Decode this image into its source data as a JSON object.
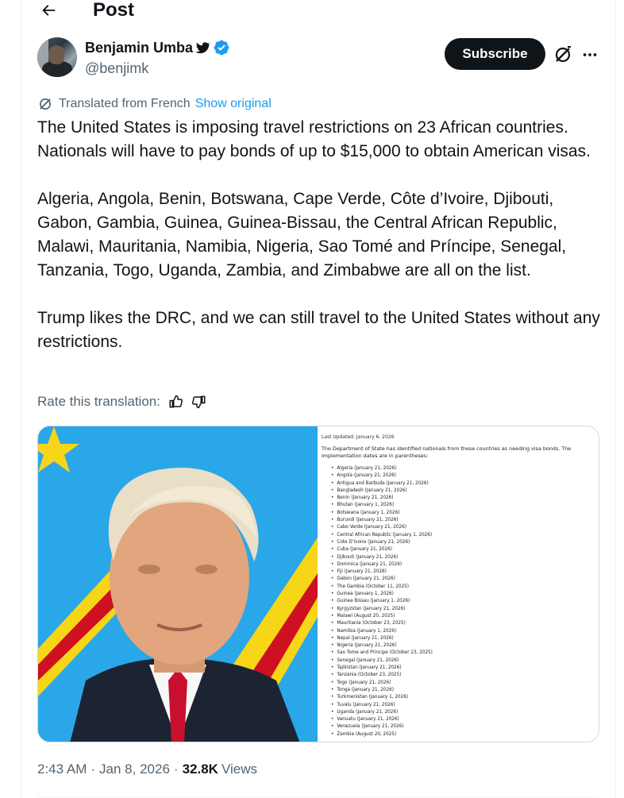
{
  "header": {
    "title": "Post"
  },
  "author": {
    "display_name": "Benjamin Umba",
    "handle": "@benjimk",
    "badge_emoji": "bird-icon",
    "verified": true
  },
  "actions": {
    "subscribe_label": "Subscribe"
  },
  "translation": {
    "note": "Translated from French",
    "show_original": "Show original",
    "rate_label": "Rate this translation:"
  },
  "tweet": {
    "paragraphs": [
      "The United States is imposing travel restrictions on 23 African countries. Nationals will have to pay bonds of up to $15,000 to obtain American visas.",
      "Algeria, Angola, Benin, Botswana, Cape Verde, Côte d’Ivoire, Djibouti, Gabon, Gambia, Guinea, Guinea-Bissau, the Central African Republic, Malawi, Mauritania, Namibia, Nigeria, Sao Tomé and Príncipe, Senegal, Tanzania, Togo, Uganda, Zambia, and Zimbabwe are all on the list.",
      "Trump likes the DRC, and we can still travel to the United States without any restrictions."
    ]
  },
  "media": {
    "doc": {
      "updated": "Last Updated: January 6, 2026",
      "intro": "The Department of State has identified nationals from these countries as needing visa bonds.  The implementation dates are in parentheses:",
      "items": [
        "Algeria (January 21, 2026)",
        "Angola (January 21, 2026)",
        "Antigua and Barbuda (January 21, 2026)",
        "Bangladesh (January 21, 2026)",
        "Benin (January 21, 2026)",
        "Bhutan (January 1, 2026)",
        "Botswana (January 1, 2026)",
        "Burundi (January 21, 2026)",
        "Cabo Verde (January 21, 2026)",
        "Central African Republic (January 1, 2026)",
        "Cote D’Ivoire (January 21, 2026)",
        "Cuba (January 21, 2026)",
        "Djibouti (January 21, 2026)",
        "Dominica (January 21, 2026)",
        "Fiji (January 21, 2026)",
        "Gabon (January 21, 2026)",
        "The Gambia (October 11, 2025)",
        "Guinea (January 1, 2026)",
        "Guinea Bissau (January 1, 2026)",
        "Kyrgyzstan (January 21, 2026)",
        "Malawi (August 20, 2025)",
        "Mauritania (October 23, 2025)",
        "Namibia (January 1, 2026)",
        "Nepal (January 21, 2026)",
        "Nigeria (January 21, 2026)",
        "Sao Tome and Principe (October 23, 2025)",
        "Senegal (January 21, 2026)",
        "Tajikistan (January 21, 2026)",
        "Tanzania (October 23, 2025)",
        "Togo (January 21, 2026)",
        "Tonga (January 21, 2026)",
        "Turkmenistan (January 1, 2026)",
        "Tuvalu (January 21, 2026)",
        "Uganda (January 21, 2026)",
        "Vanuatu (January 21, 2026)",
        "Venezuela (January 21, 2026)",
        "Zambia (August 20, 2025)"
      ]
    }
  },
  "meta": {
    "time": "2:43 AM",
    "date": "Jan 8, 2026",
    "views_count": "32.8K",
    "views_label": "Views",
    "separator": "·"
  },
  "colors": {
    "accent": "#1d9bf0",
    "text": "#0f1419",
    "muted": "#536471",
    "flag_blue": "#2aa7e8",
    "flag_red": "#ce1021",
    "flag_yellow": "#f7d618"
  }
}
